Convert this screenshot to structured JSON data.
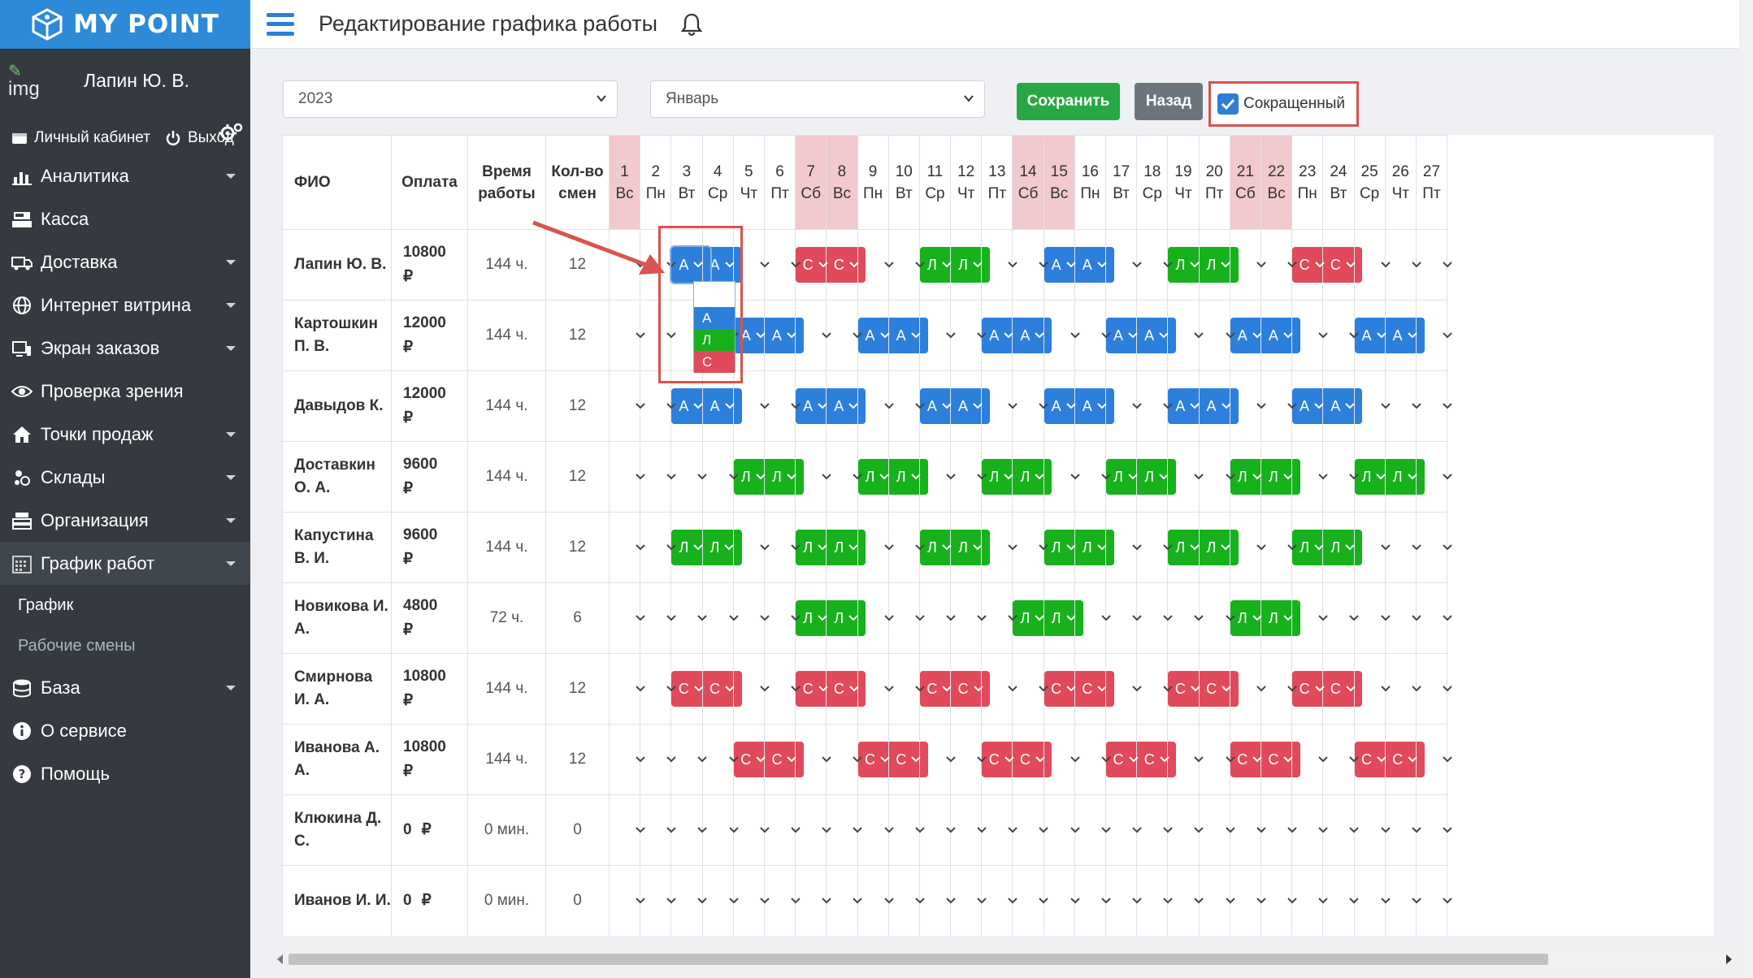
{
  "app": {
    "brand": "MY POINT"
  },
  "user": {
    "img_alt": "img",
    "name": "Лапин Ю. В.",
    "cabinet": "Личный кабинет",
    "logout": "Выход"
  },
  "menu": [
    {
      "label": "Аналитика",
      "icon": "chart-icon",
      "caret": true
    },
    {
      "label": "Касса",
      "icon": "cash-register-icon",
      "caret": false
    },
    {
      "label": "Доставка",
      "icon": "truck-icon",
      "caret": true
    },
    {
      "label": "Интернет витрина",
      "icon": "globe-icon",
      "caret": true
    },
    {
      "label": "Экран заказов",
      "icon": "screen-icon",
      "caret": true
    },
    {
      "label": "Проверка зрения",
      "icon": "eye-icon",
      "caret": false
    },
    {
      "label": "Точки продаж",
      "icon": "home-icon",
      "caret": true
    },
    {
      "label": "Склады",
      "icon": "warehouse-icon",
      "caret": true
    },
    {
      "label": "Организация",
      "icon": "organization-icon",
      "caret": true
    },
    {
      "label": "График работ",
      "icon": "calendar-icon",
      "caret": true,
      "active": true
    }
  ],
  "submenu": [
    "График",
    "Рабочие смены"
  ],
  "menu_bottom": [
    {
      "label": "База",
      "icon": "database-icon",
      "caret": true
    },
    {
      "label": "О сервисе",
      "icon": "info-icon",
      "caret": false
    },
    {
      "label": "Помощь",
      "icon": "help-icon",
      "caret": false
    }
  ],
  "header": {
    "title": "Редактирование графика работы"
  },
  "controls": {
    "year": "2023",
    "month": "Январь",
    "save_label": "Сохранить",
    "back_label": "Назад",
    "short_label": "Сокращенный",
    "short_checked": true
  },
  "table": {
    "headers": {
      "fio": "ФИО",
      "pay": "Оплата",
      "time": "Время работы",
      "shifts": "Кол-во смен"
    },
    "days": [
      {
        "n": "1",
        "d": "Вс",
        "wk": true
      },
      {
        "n": "2",
        "d": "Пн"
      },
      {
        "n": "3",
        "d": "Вт"
      },
      {
        "n": "4",
        "d": "Ср"
      },
      {
        "n": "5",
        "d": "Чт"
      },
      {
        "n": "6",
        "d": "Пт"
      },
      {
        "n": "7",
        "d": "Сб",
        "wk": true
      },
      {
        "n": "8",
        "d": "Вс",
        "wk": true
      },
      {
        "n": "9",
        "d": "Пн"
      },
      {
        "n": "10",
        "d": "Вт"
      },
      {
        "n": "11",
        "d": "Ср"
      },
      {
        "n": "12",
        "d": "Чт"
      },
      {
        "n": "13",
        "d": "Пт"
      },
      {
        "n": "14",
        "d": "Сб",
        "wk": true
      },
      {
        "n": "15",
        "d": "Вс",
        "wk": true
      },
      {
        "n": "16",
        "d": "Пн"
      },
      {
        "n": "17",
        "d": "Вт"
      },
      {
        "n": "18",
        "d": "Ср"
      },
      {
        "n": "19",
        "d": "Чт"
      },
      {
        "n": "20",
        "d": "Пт"
      },
      {
        "n": "21",
        "d": "Сб",
        "wk": true
      },
      {
        "n": "22",
        "d": "Вс",
        "wk": true
      },
      {
        "n": "23",
        "d": "Пн"
      },
      {
        "n": "24",
        "d": "Вт"
      },
      {
        "n": "25",
        "d": "Ср"
      },
      {
        "n": "26",
        "d": "Чт"
      },
      {
        "n": "27",
        "d": "Пт"
      }
    ],
    "currency": "₽",
    "rows": [
      {
        "fio": "Лапин Ю. В.",
        "pay": "10800",
        "time": "144 ч.",
        "shifts": "12",
        "cells": [
          "",
          "",
          "А",
          "А",
          "",
          "",
          "С",
          "С",
          "",
          "",
          "Л",
          "Л",
          "",
          "",
          "А",
          "А",
          "",
          "",
          "Л",
          "Л",
          "",
          "",
          "С",
          "С",
          "",
          "",
          ""
        ]
      },
      {
        "fio": "Картошкин П. В.",
        "pay": "12000",
        "time": "144 ч.",
        "shifts": "12",
        "cells": [
          "",
          "",
          "",
          "",
          "А",
          "А",
          "",
          "",
          "А",
          "А",
          "",
          "",
          "А",
          "А",
          "",
          "",
          "А",
          "А",
          "",
          "",
          "А",
          "А",
          "",
          "",
          "А",
          "А",
          ""
        ]
      },
      {
        "fio": "Давыдов К.",
        "pay": "12000",
        "time": "144 ч.",
        "shifts": "12",
        "cells": [
          "",
          "",
          "А",
          "А",
          "",
          "",
          "А",
          "А",
          "",
          "",
          "А",
          "А",
          "",
          "",
          "А",
          "А",
          "",
          "",
          "А",
          "А",
          "",
          "",
          "А",
          "А",
          "",
          "",
          ""
        ]
      },
      {
        "fio": "Доставкин О. А.",
        "pay": "9600",
        "time": "144 ч.",
        "shifts": "12",
        "cells": [
          "",
          "",
          "",
          "",
          "Л",
          "Л",
          "",
          "",
          "Л",
          "Л",
          "",
          "",
          "Л",
          "Л",
          "",
          "",
          "Л",
          "Л",
          "",
          "",
          "Л",
          "Л",
          "",
          "",
          "Л",
          "Л",
          ""
        ]
      },
      {
        "fio": "Капустина В. И.",
        "pay": "9600",
        "time": "144 ч.",
        "shifts": "12",
        "cells": [
          "",
          "",
          "Л",
          "Л",
          "",
          "",
          "Л",
          "Л",
          "",
          "",
          "Л",
          "Л",
          "",
          "",
          "Л",
          "Л",
          "",
          "",
          "Л",
          "Л",
          "",
          "",
          "Л",
          "Л",
          "",
          "",
          ""
        ]
      },
      {
        "fio": "Новикова И. А.",
        "pay": "4800",
        "time": "72 ч.",
        "shifts": "6",
        "cells": [
          "",
          "",
          "",
          "",
          "",
          "",
          "Л",
          "Л",
          "",
          "",
          "",
          "",
          "",
          "Л",
          "Л",
          "",
          "",
          "",
          "",
          "",
          "Л",
          "Л",
          "",
          "",
          "",
          "",
          ""
        ]
      },
      {
        "fio": "Смирнова И. А.",
        "pay": "10800",
        "time": "144 ч.",
        "shifts": "12",
        "cells": [
          "",
          "",
          "С",
          "С",
          "",
          "",
          "С",
          "С",
          "",
          "",
          "С",
          "С",
          "",
          "",
          "С",
          "С",
          "",
          "",
          "С",
          "С",
          "",
          "",
          "С",
          "С",
          "",
          "",
          ""
        ]
      },
      {
        "fio": "Иванова А. А.",
        "pay": "10800",
        "time": "144 ч.",
        "shifts": "12",
        "cells": [
          "",
          "",
          "",
          "",
          "С",
          "С",
          "",
          "",
          "С",
          "С",
          "",
          "",
          "С",
          "С",
          "",
          "",
          "С",
          "С",
          "",
          "",
          "С",
          "С",
          "",
          "",
          "С",
          "С",
          ""
        ]
      },
      {
        "fio": "Клюкина Д. С.",
        "pay": "0",
        "time": "0 мин.",
        "shifts": "0",
        "cells": [
          "",
          "",
          "",
          "",
          "",
          "",
          "",
          "",
          "",
          "",
          "",
          "",
          "",
          "",
          "",
          "",
          "",
          "",
          "",
          "",
          "",
          "",
          "",
          "",
          "",
          "",
          ""
        ]
      },
      {
        "fio": "Иванов И. И.",
        "pay": "0",
        "time": "0 мин.",
        "shifts": "0",
        "cells": [
          "",
          "",
          "",
          "",
          "",
          "",
          "",
          "",
          "",
          "",
          "",
          "",
          "",
          "",
          "",
          "",
          "",
          "",
          "",
          "",
          "",
          "",
          "",
          "",
          "",
          "",
          ""
        ]
      }
    ]
  },
  "dropdown": {
    "options": [
      "",
      "А",
      "Л",
      "С"
    ]
  },
  "colors": {
    "A": "#2d7fdc",
    "L": "#17b11c",
    "C": "#e04a5b",
    "weekend": "#f2c9cd",
    "accent": "#2c8ad8"
  }
}
